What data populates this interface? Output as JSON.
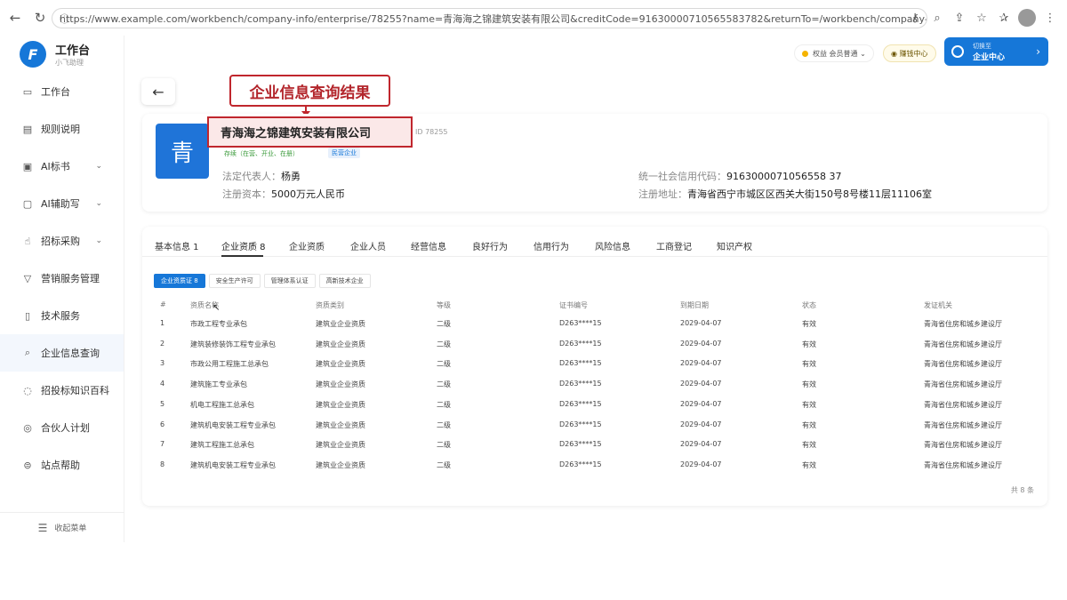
{
  "browser": {
    "url": "https://www.example.com/workbench/company-info/enterprise/78255?name=青海海之锦建筑安装有限公司&creditCode=91630000710565583782&returnTo=/workbench/company-info/enterprise"
  },
  "sidebar": {
    "app_title": "工作台",
    "app_sub": "小飞助理",
    "logo_letter": "F",
    "items": [
      {
        "label": "工作台",
        "icon": "monitor-icon",
        "has_chevron": false
      },
      {
        "label": "规则说明",
        "icon": "document-icon",
        "has_chevron": false
      },
      {
        "label": "AI标书",
        "icon": "file-icon",
        "has_chevron": true
      },
      {
        "label": "AI辅助写",
        "icon": "edit-icon",
        "has_chevron": true
      },
      {
        "label": "招标采购",
        "icon": "hand-icon",
        "has_chevron": true
      },
      {
        "label": "营销服务管理",
        "icon": "filter-icon",
        "has_chevron": false
      },
      {
        "label": "技术服务",
        "icon": "jar-icon",
        "has_chevron": false
      },
      {
        "label": "企业信息查询",
        "icon": "search-icon",
        "has_chevron": false
      },
      {
        "label": "招投标知识百科",
        "icon": "chat-icon",
        "has_chevron": false
      },
      {
        "label": "合伙人计划",
        "icon": "ring-icon",
        "has_chevron": false
      },
      {
        "label": "站点帮助",
        "icon": "help-icon",
        "has_chevron": false
      }
    ],
    "collapse_label": "收起菜单"
  },
  "header": {
    "tag1_label": "权益",
    "tag1_value": "会员普通",
    "tag2_label": "赚钱中心",
    "user_line1": "切换至",
    "user_line2": "企业中心"
  },
  "callout": "企业信息查询结果",
  "company": {
    "avatar_char": "青",
    "name": "青海海之锦建筑安装有限公司",
    "id_label": "ID 78255",
    "status_tag": "存续（在营、开业、在册）",
    "type_tag": "民营企业",
    "legal_rep_label": "法定代表人：",
    "legal_rep": "杨勇",
    "capital_label": "注册资本：",
    "capital": "5000万元人民币",
    "credit_label": "统一社会信用代码：",
    "credit_code": "9163000071056558 37",
    "address_label": "注册地址：",
    "address": "青海省西宁市城区区西关大街150号8号楼11层11106室"
  },
  "tabs": [
    "基本信息 1",
    "企业资质 8",
    "企业资质",
    "企业人员",
    "经营信息",
    "良好行为",
    "信用行为",
    "风险信息",
    "工商登记",
    "知识产权"
  ],
  "subtabs": [
    "企业资质证 8",
    "安全生产许可",
    "管理体系认证",
    "高新技术企业"
  ],
  "table": {
    "headers": [
      "#",
      "资质名称",
      "资质类别",
      "等级",
      "证书编号",
      "到期日期",
      "状态",
      "发证机关"
    ],
    "rows": [
      [
        "1",
        "市政工程专业承包",
        "建筑业企业资质",
        "二级",
        "D263****15",
        "2029-04-07",
        "有效",
        "青海省住房和城乡建设厅"
      ],
      [
        "2",
        "建筑装修装饰工程专业承包",
        "建筑业企业资质",
        "二级",
        "D263****15",
        "2029-04-07",
        "有效",
        "青海省住房和城乡建设厅"
      ],
      [
        "3",
        "市政公用工程施工总承包",
        "建筑业企业资质",
        "二级",
        "D263****15",
        "2029-04-07",
        "有效",
        "青海省住房和城乡建设厅"
      ],
      [
        "4",
        "建筑施工专业承包",
        "建筑业企业资质",
        "二级",
        "D263****15",
        "2029-04-07",
        "有效",
        "青海省住房和城乡建设厅"
      ],
      [
        "5",
        "机电工程施工总承包",
        "建筑业企业资质",
        "二级",
        "D263****15",
        "2029-04-07",
        "有效",
        "青海省住房和城乡建设厅"
      ],
      [
        "6",
        "建筑机电安装工程专业承包",
        "建筑业企业资质",
        "二级",
        "D263****15",
        "2029-04-07",
        "有效",
        "青海省住房和城乡建设厅"
      ],
      [
        "7",
        "建筑工程施工总承包",
        "建筑业企业资质",
        "二级",
        "D263****15",
        "2029-04-07",
        "有效",
        "青海省住房和城乡建设厅"
      ],
      [
        "8",
        "建筑机电安装工程专业承包",
        "建筑业企业资质",
        "二级",
        "D263****15",
        "2029-04-07",
        "有效",
        "青海省住房和城乡建设厅"
      ]
    ],
    "total": "共 8 条"
  }
}
